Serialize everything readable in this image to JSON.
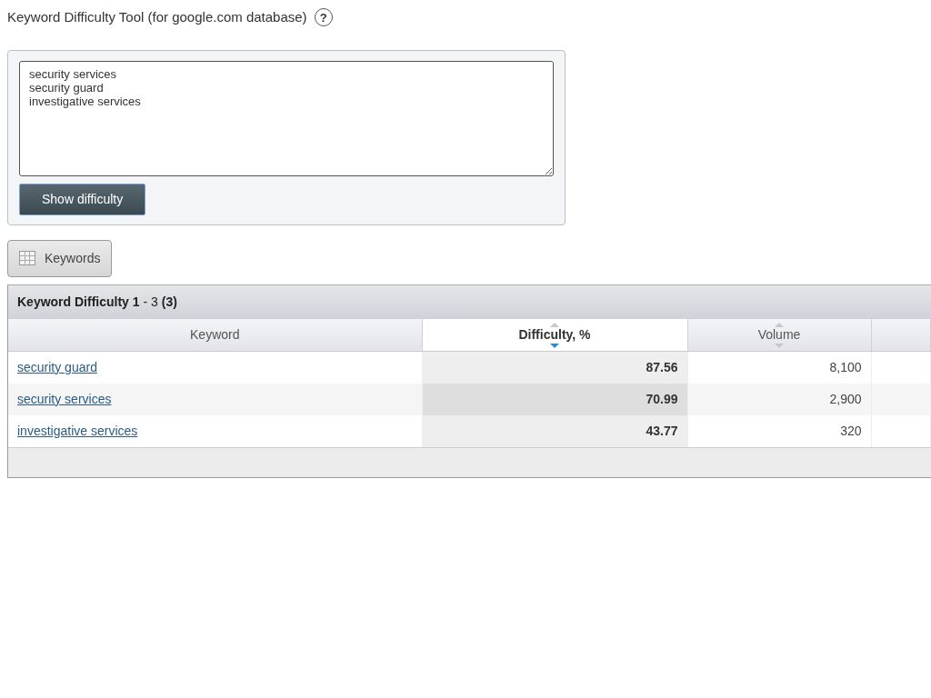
{
  "page_title": "Keyword Difficulty Tool (for google.com database)",
  "help_icon": "?",
  "keywords_input": {
    "value": "security services\nsecurity guard\ninvestigative services"
  },
  "submit_button": "Show difficulty",
  "view_tabs": [
    {
      "label": "Keywords"
    }
  ],
  "table": {
    "title": "**Keyword Difficulty 1** - 3 **(3)**",
    "columns": [
      {
        "label": "Keyword",
        "sortable": false,
        "selected": false
      },
      {
        "label": "Difficulty, %",
        "sortable": true,
        "selected": true
      },
      {
        "label": "Volume",
        "sortable": true,
        "selected": false
      }
    ],
    "rows": [
      {
        "keyword": "security guard",
        "difficulty": "87.56",
        "volume": "8,100"
      },
      {
        "keyword": "security services",
        "difficulty": "70.99",
        "volume": "2,900"
      },
      {
        "keyword": "investigative services",
        "difficulty": "43.77",
        "volume": "320"
      }
    ]
  }
}
